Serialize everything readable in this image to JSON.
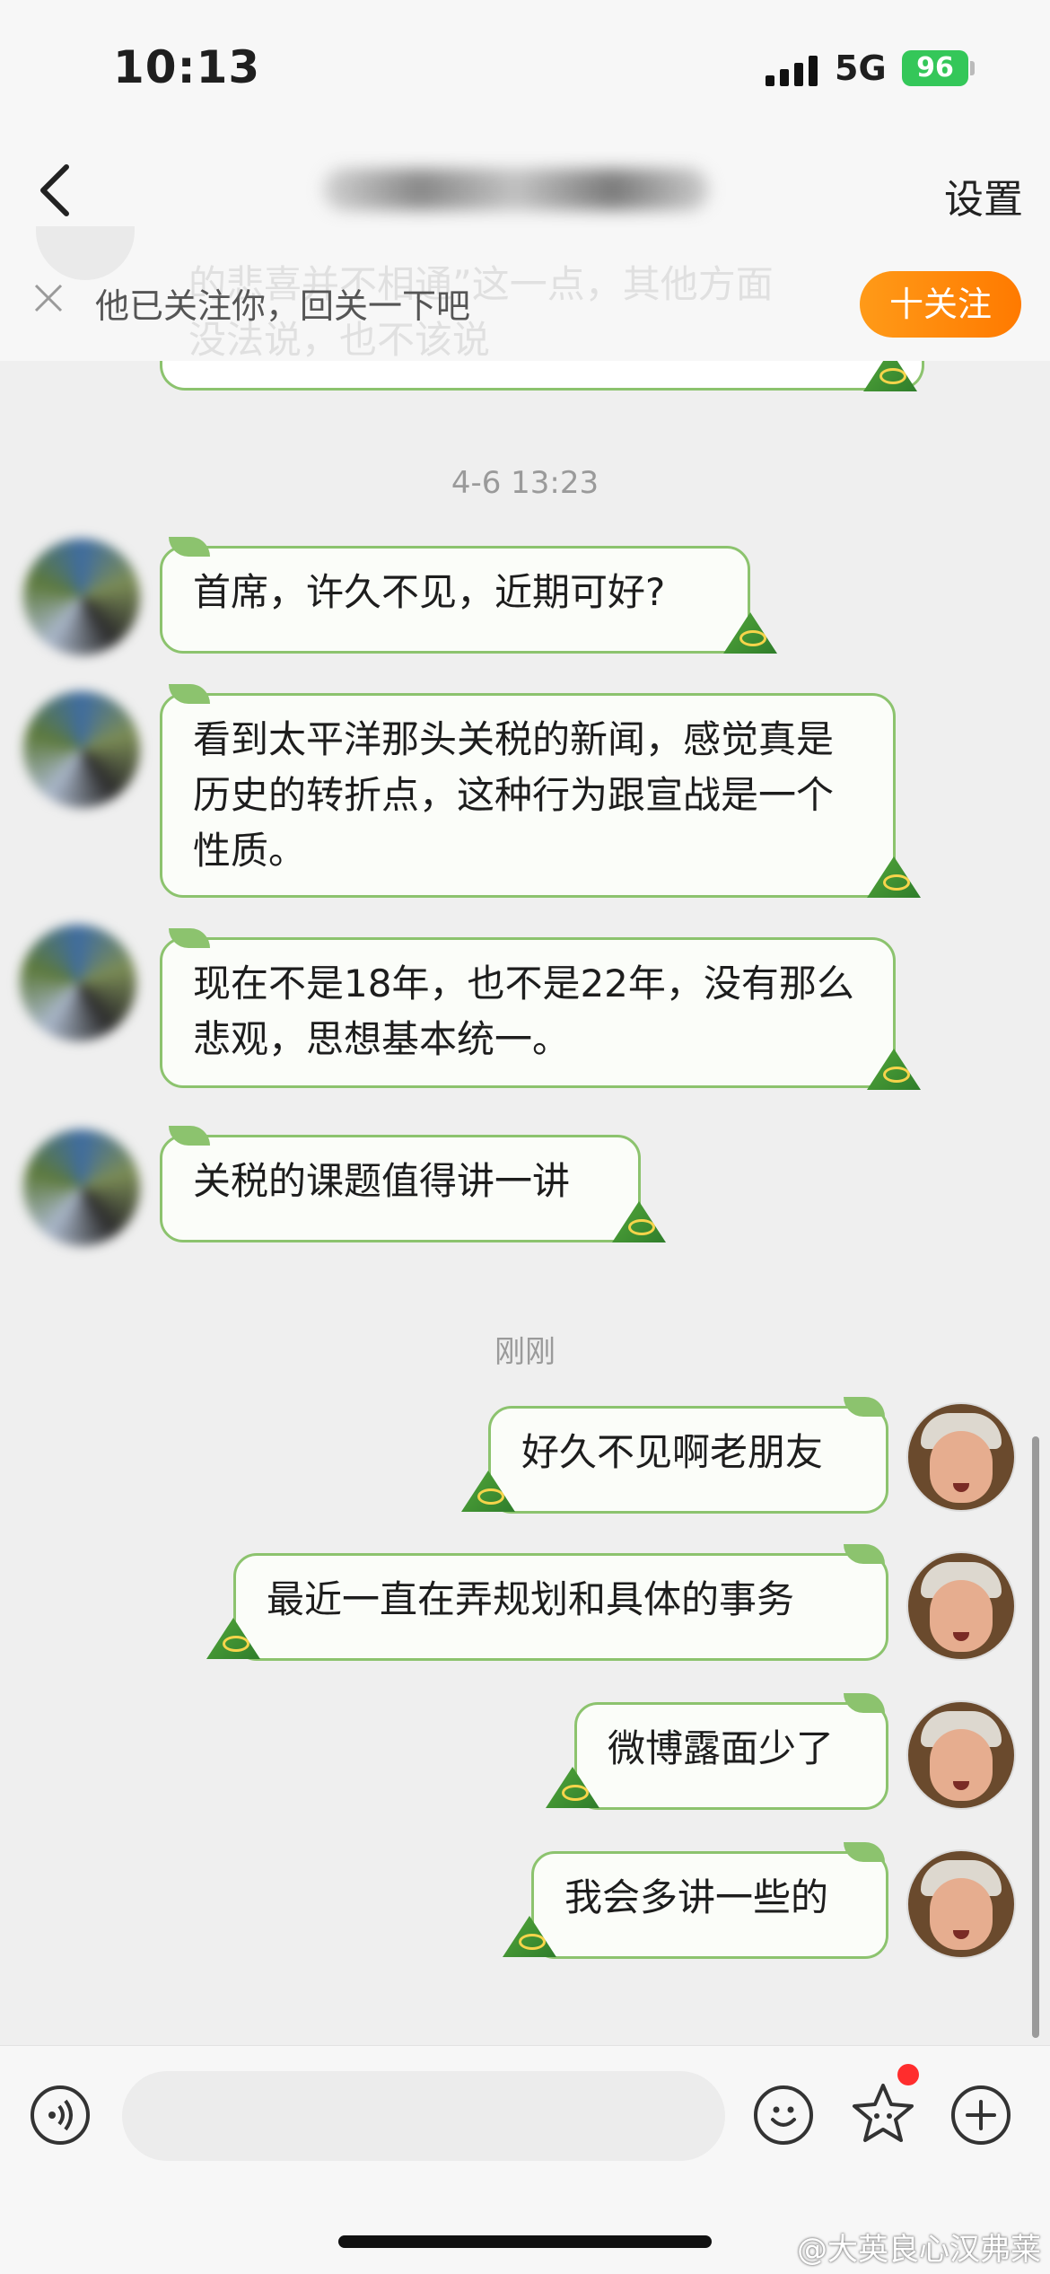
{
  "status_bar": {
    "time": "10:13",
    "network": "5G",
    "battery": "96"
  },
  "nav": {
    "settings": "设置"
  },
  "follow_banner": {
    "text": "他已关注你，回关一下吧",
    "button": "十关注",
    "behind_lines": [
      "的悲喜并不相通”这一点，其他方面",
      "没法说，也不该说"
    ]
  },
  "messages": {
    "timestamp1": "4-6 13:23",
    "timestamp2": "刚刚",
    "received": [
      "首席，许久不见，近期可好?",
      "看到太平洋那头关税的新闻，感觉真是历史的转折点，这种行为跟宣战是一个性质。",
      "现在不是18年，也不是22年，没有那么悲观，思想基本统一。",
      "关税的课题值得讲一讲"
    ],
    "sent": [
      "好久不见啊老朋友",
      "最近一直在弄规划和具体的事务",
      "微博露面少了",
      "我会多讲一些的"
    ]
  },
  "watermark": "@大英良心汉弗莱",
  "colors": {
    "bubble_border": "#8cc36e",
    "follow_button": "#ff8a00",
    "badge": "#ff2d2d",
    "battery": "#34c759"
  },
  "icons": [
    "back-arrow-icon",
    "close-icon",
    "voice-icon",
    "emoji-icon",
    "sticker-icon",
    "plus-icon",
    "signal-icon",
    "battery-icon"
  ]
}
